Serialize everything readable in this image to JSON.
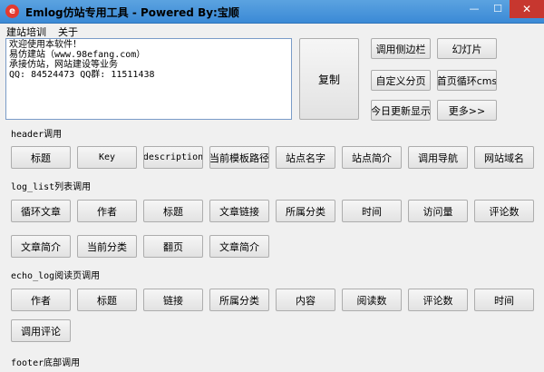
{
  "window": {
    "title": "Emlog仿站专用工具 - Powered By:宝顺",
    "min_glyph": "—",
    "max_glyph": "☐",
    "close_glyph": "✕"
  },
  "menu": [
    "建站培训",
    "关于"
  ],
  "info_text": "欢迎使用本软件！\n易仿建站（www.98efang.com）\n承接仿站，网站建设等业务\nQQ: 84524473 QQ群: 11511438",
  "copy_label": "复制",
  "top_buttons": [
    "调用侧边栏",
    "幻灯片",
    "自定义分页",
    "首页循环cms",
    "今日更新显示",
    "更多>>"
  ],
  "sections": [
    {
      "label_prefix": "header",
      "label_suffix": "调用",
      "buttons": [
        "标题",
        "Key",
        "description",
        "当前模板路径",
        "站点名字",
        "站点简介",
        "调用导航",
        "网站域名"
      ]
    },
    {
      "label_prefix": "log_list",
      "label_suffix": "列表调用",
      "buttons": [
        "循环文章",
        "作者",
        "标题",
        "文章链接",
        "所属分类",
        "时间",
        "访问量",
        "评论数",
        "文章简介",
        "当前分类",
        "翻页",
        "文章简介"
      ]
    },
    {
      "label_prefix": "echo_log",
      "label_suffix": "阅读页调用",
      "buttons": [
        "作者",
        "标题",
        "链接",
        "所属分类",
        "内容",
        "阅读数",
        "评论数",
        "时间",
        "调用评论"
      ]
    },
    {
      "label_prefix": "footer",
      "label_suffix": "底部调用",
      "buttons": []
    }
  ]
}
